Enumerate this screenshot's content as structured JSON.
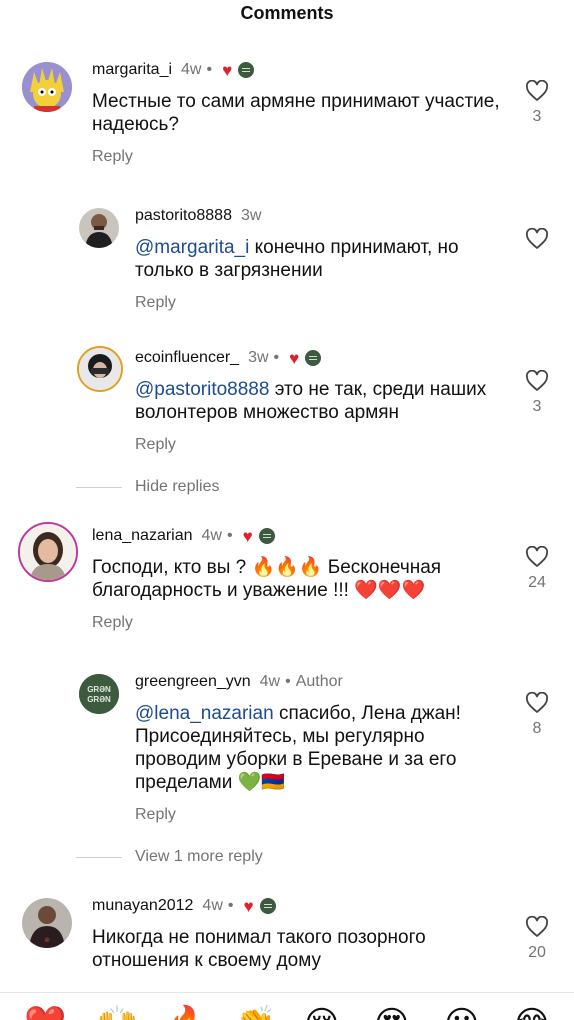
{
  "header": {
    "title": "Comments"
  },
  "comments": [
    {
      "username": "margarita_i",
      "time": "4w",
      "text": "Местные то сами армяне принимают участие, надеюсь?",
      "reply": "Reply",
      "likes": "3"
    },
    {
      "username": "pastorito8888",
      "time": "3w",
      "mention": "@margarita_i",
      "text": " конечно принимают, но только в загрязнении",
      "reply": "Reply"
    },
    {
      "username": "ecoinfluencer_",
      "time": "3w",
      "mention": "@pastorito8888",
      "text": " это не так, среди наших волонтеров множество армян",
      "reply": "Reply",
      "likes": "3"
    },
    {
      "username": "lena_nazarian",
      "time": "4w",
      "text": "Господи, кто вы ? 🔥🔥🔥 Бесконечная благодарность и уважение !!! ❤️❤️❤️",
      "reply": "Reply",
      "likes": "24"
    },
    {
      "username": "greengreen_yvn",
      "time": "4w",
      "author": "Author",
      "mention": "@lena_nazarian",
      "text": " спасибо, Лена джан! Присоединяйтесь, мы регулярно проводим уборки в Ереване и за его пределами 💚🇦🇲",
      "reply": "Reply",
      "likes": "8"
    },
    {
      "username": "munayan2012",
      "time": "4w",
      "text": "Никогда не понимал такого позорного отношения к своему дому",
      "likes": "20"
    }
  ],
  "thread_links": {
    "hide_replies": "Hide replies",
    "view_more": "View 1 more reply"
  },
  "separator": "•",
  "reactions": [
    "❤️",
    "🙌",
    "🔥",
    "👏",
    "😢",
    "😍",
    "😮",
    "😂"
  ],
  "icons": {
    "like": "heart-outline-icon",
    "badge_heart": "heart-filled-icon",
    "badge_logo": "greengreen-logo-icon"
  },
  "colors": {
    "mention": "#1d4b8f",
    "muted": "#737373",
    "heart": "#e0202a"
  }
}
